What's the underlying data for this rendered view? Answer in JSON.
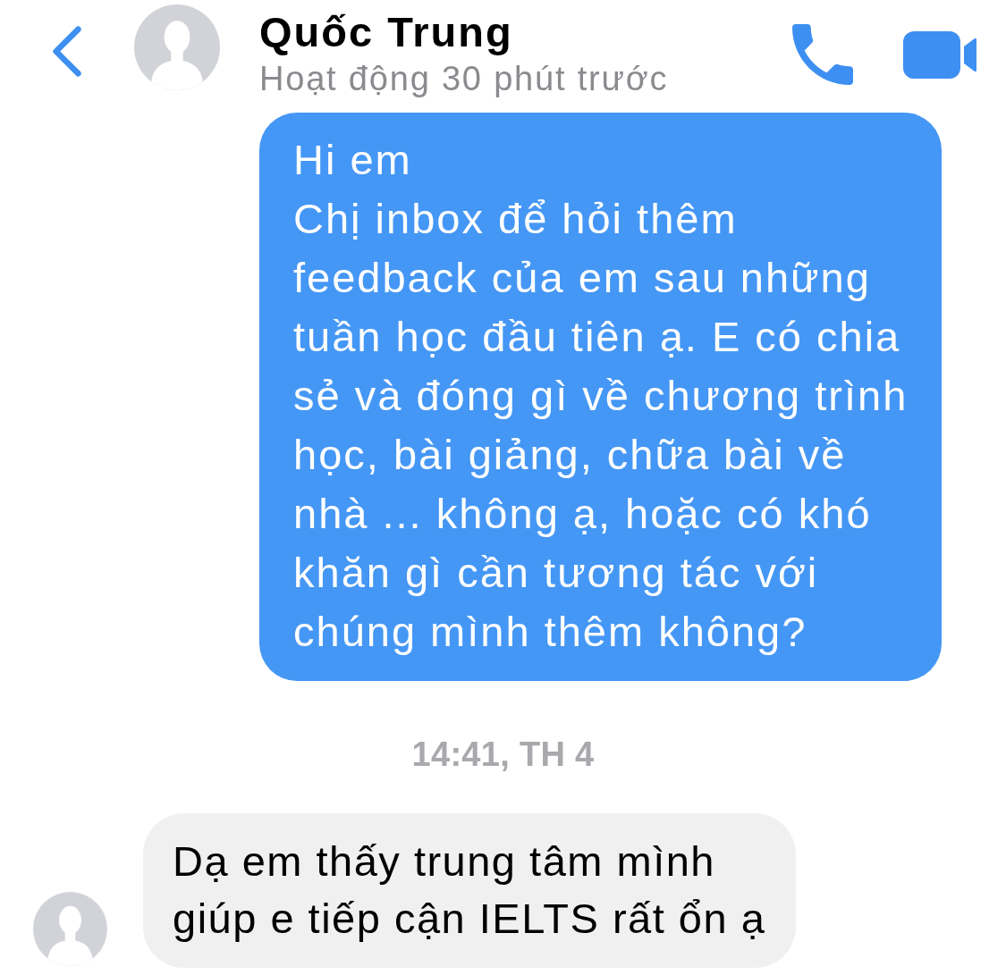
{
  "header": {
    "contact": {
      "name": "Quốc Trung",
      "status": "Hoạt động 30 phút trước"
    }
  },
  "messages": [
    {
      "kind": "outgoing",
      "text": "Hi em\nChị inbox để hỏi thêm feedback của em sau những tuần học đầu tiên ạ. E có chia sẻ và đóng gì về chương trình học, bài giảng, chữa bài về nhà ... không ạ, hoặc có khó khăn gì cần tương tác với chúng mình thêm không?"
    },
    {
      "kind": "timestamp",
      "text": "14:41, TH 4"
    },
    {
      "kind": "incoming",
      "text": "Dạ em thấy trung tâm mình giúp e tiếp cận IELTS rất ổn ạ",
      "show_avatar": true
    }
  ]
}
